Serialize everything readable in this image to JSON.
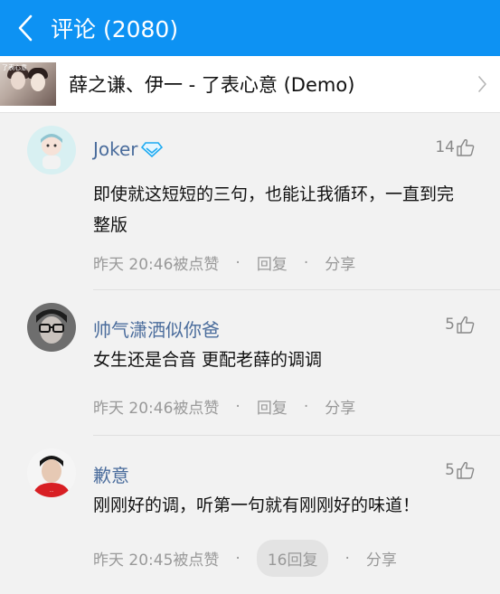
{
  "header": {
    "title": "评论 (2080)"
  },
  "song": {
    "title": "薛之谦、伊一 - 了表心意 (Demo)",
    "cover_text": "了表心意"
  },
  "comments": [
    {
      "username": "Joker",
      "likes": "14",
      "text": "即使就这短短的三句，也能让我循环，一直到完整版",
      "time": "昨天 20:46被点赞",
      "reply": "回复",
      "share": "分享"
    },
    {
      "username": "帅气潇洒似你爸",
      "likes": "5",
      "text": "女生还是合音  更配老薛的调调",
      "time": "昨天 20:46被点赞",
      "reply": "回复",
      "share": "分享"
    },
    {
      "username": "歉意",
      "likes": "5",
      "text": "刚刚好的调，听第一句就有刚刚好的味道！",
      "time": "昨天 20:45被点赞",
      "reply": "16回复",
      "share": "分享"
    }
  ],
  "colors": {
    "header_bg": "#0d92f3",
    "username": "#4a6c9c"
  }
}
